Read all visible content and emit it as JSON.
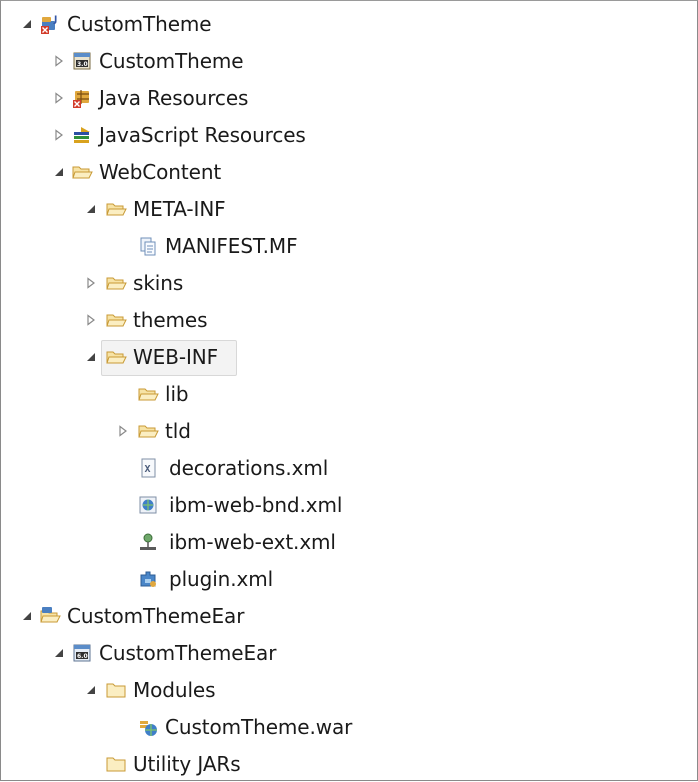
{
  "tree": {
    "items": [
      {
        "label": "CustomTheme",
        "icon": "java-ee-project-icon",
        "expanded": true
      },
      {
        "label": "CustomTheme",
        "icon": "servlet-3.0-descriptor-icon",
        "expanded": false
      },
      {
        "label": "Java Resources",
        "icon": "java-resources-icon",
        "expanded": false
      },
      {
        "label": "JavaScript Resources",
        "icon": "javascript-resources-icon",
        "expanded": false
      },
      {
        "label": "WebContent",
        "icon": "folder-open-icon",
        "expanded": true
      },
      {
        "label": "META-INF",
        "icon": "folder-open-icon",
        "expanded": true
      },
      {
        "label": "MANIFEST.MF",
        "icon": "manifest-file-icon"
      },
      {
        "label": "skins",
        "icon": "folder-open-icon",
        "expanded": false
      },
      {
        "label": "themes",
        "icon": "folder-open-icon",
        "expanded": false
      },
      {
        "label": "WEB-INF",
        "icon": "folder-open-icon",
        "expanded": true,
        "selected": true
      },
      {
        "label": "lib",
        "icon": "folder-open-icon"
      },
      {
        "label": "tld",
        "icon": "folder-open-icon",
        "expanded": false
      },
      {
        "label": "decorations.xml",
        "icon": "xml-file-icon"
      },
      {
        "label": "ibm-web-bnd.xml",
        "icon": "bindings-file-icon"
      },
      {
        "label": "ibm-web-ext.xml",
        "icon": "extensions-file-icon"
      },
      {
        "label": "plugin.xml",
        "icon": "plugin-file-icon"
      },
      {
        "label": "CustomThemeEar",
        "icon": "ear-project-icon",
        "expanded": true
      },
      {
        "label": "CustomThemeEar",
        "icon": "ear-6.0-descriptor-icon",
        "expanded": true
      },
      {
        "label": "Modules",
        "icon": "folder-closed-icon",
        "expanded": true
      },
      {
        "label": "CustomTheme.war",
        "icon": "war-module-icon"
      },
      {
        "label": "Utility JARs",
        "icon": "folder-closed-icon"
      }
    ]
  }
}
